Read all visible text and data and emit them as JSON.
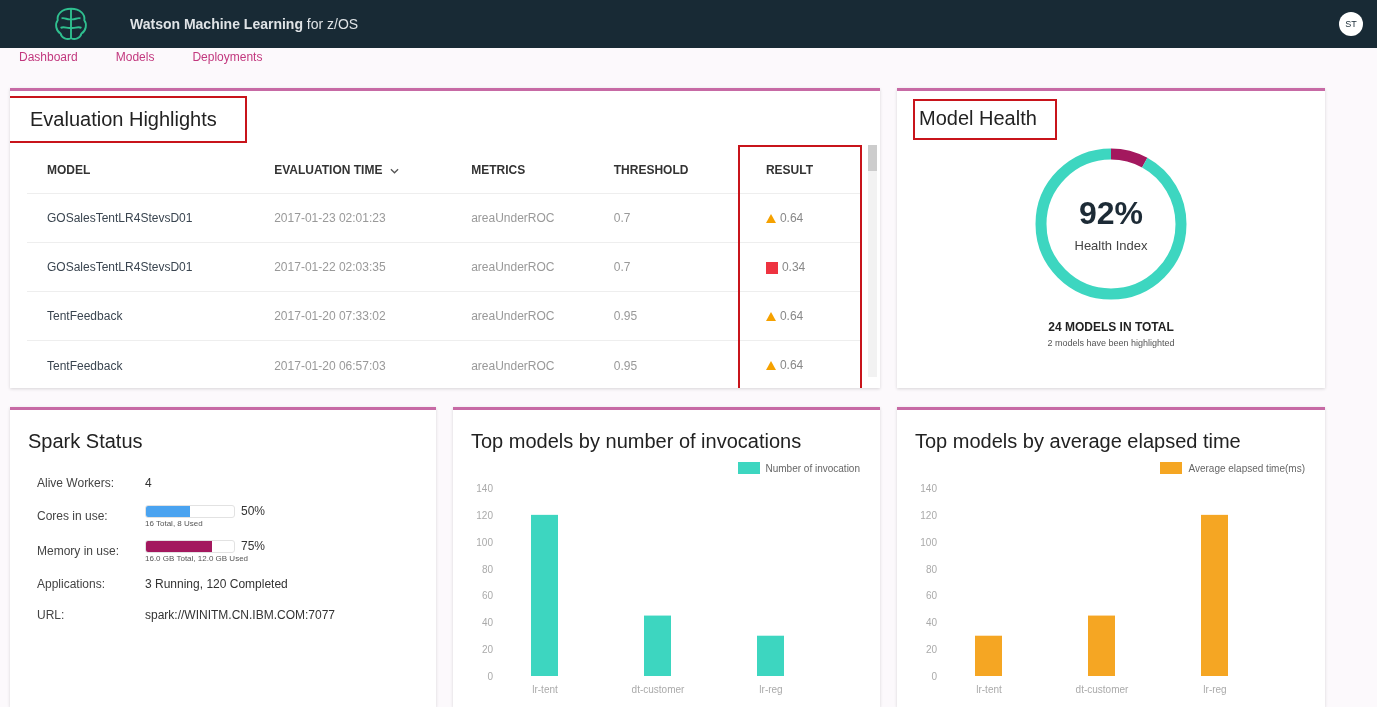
{
  "header": {
    "title": "**Watson Machine Learning** for z/OS",
    "avatar": "ST"
  },
  "nav": [
    "Dashboard",
    "Models",
    "Deployments"
  ],
  "evaluation": {
    "title": "Evaluation Highlights",
    "annotated": true,
    "columns": [
      {
        "label": "MODEL",
        "sort": false,
        "annotated": false
      },
      {
        "label": "EVALUATION TIME",
        "sort": true,
        "annotated": false
      },
      {
        "label": "METRICS",
        "sort": false,
        "annotated": false
      },
      {
        "label": "THRESHOLD",
        "sort": false,
        "annotated": false
      },
      {
        "label": "RESULT",
        "sort": false,
        "annotated": true
      }
    ],
    "rows": [
      {
        "model": "GOSalesTentLR4StevsD01",
        "time": "2017-01-23 02:01:23",
        "metric": "areaUnderROC",
        "threshold": "0.7",
        "result": {
          "kind": "warning",
          "value": "0.64"
        }
      },
      {
        "model": "GOSalesTentLR4StevsD01",
        "time": "2017-01-22 02:03:35",
        "metric": "areaUnderROC",
        "threshold": "0.7",
        "result": {
          "kind": "error",
          "value": "0.34"
        }
      },
      {
        "model": "TentFeedback",
        "time": "2017-01-20 07:33:02",
        "metric": "areaUnderROC",
        "threshold": "0.95",
        "result": {
          "kind": "warning",
          "value": "0.64"
        }
      },
      {
        "model": "TentFeedback",
        "time": "2017-01-20 06:57:03",
        "metric": "areaUnderROC",
        "threshold": "0.95",
        "result": {
          "kind": "warning",
          "value": "0.64"
        }
      }
    ]
  },
  "health": {
    "title": "Model Health",
    "annotated": true,
    "level": 0.92,
    "percent": "92%",
    "label": "Health Index",
    "total": "24 MODELS IN TOTAL",
    "note": "2 models have been highlighted"
  },
  "spark": {
    "title": "Spark Status",
    "rows": [
      {
        "kind": "text",
        "label": "Alive Workers:",
        "value": "4"
      },
      {
        "kind": "meter",
        "label": "Cores in use:",
        "level": 0.5,
        "color": "#4aa3f0",
        "reading": "50%",
        "detail": "16 Total, 8 Used"
      },
      {
        "kind": "meter",
        "label": "Memory in use:",
        "level": 0.75,
        "color": "#a3185e",
        "reading": "75%",
        "detail": "16.0 GB Total, 12.0 GB Used"
      },
      {
        "kind": "text",
        "label": "Applications:",
        "value": "3 Running, 120 Completed"
      },
      {
        "kind": "text",
        "label": "URL:",
        "value": "spark://WINITM.CN.IBM.COM:7077"
      }
    ]
  },
  "charts": [
    {
      "chart_data": {
        "type": "bar",
        "title": "Top models by number of invocations",
        "categories": [
          "lr-tent",
          "dt-customer",
          "lr-reg"
        ],
        "series": [
          {
            "name": "Number of invocation",
            "color": "#3dd6c0",
            "values": [
              120,
              45,
              30
            ]
          }
        ],
        "ylim": [
          0,
          140
        ],
        "yticks": [
          0,
          20,
          40,
          60,
          80,
          100,
          120,
          140
        ]
      }
    },
    {
      "chart_data": {
        "type": "bar",
        "title": "Top models by average elapsed time",
        "categories": [
          "lr-tent",
          "dt-customer",
          "lr-reg"
        ],
        "series": [
          {
            "name": "Average elapsed time(ms)",
            "color": "#f5a623",
            "values": [
              30,
              45,
              120
            ]
          }
        ],
        "ylim": [
          0,
          140
        ],
        "yticks": [
          0,
          20,
          40,
          60,
          80,
          100,
          120,
          140
        ]
      }
    }
  ]
}
